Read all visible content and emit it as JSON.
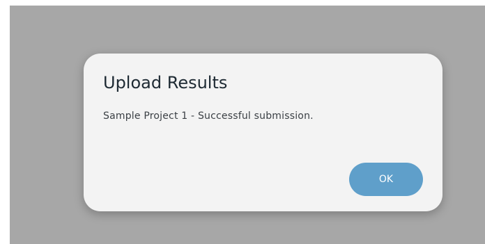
{
  "dialog": {
    "title": "Upload Results",
    "message": "Sample Project 1 - Successful submission.",
    "ok_label": "OK"
  },
  "colors": {
    "backdrop": "#a7a7a7",
    "dialog_background": "#f3f3f3",
    "button_background": "#5f9fca",
    "button_text": "#ffffff",
    "title_text": "#1e2a33"
  }
}
